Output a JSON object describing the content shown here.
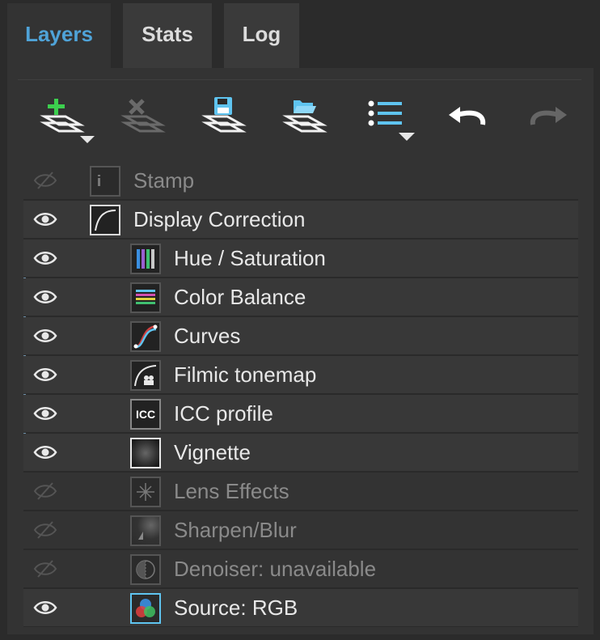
{
  "tabs": [
    {
      "label": "Layers"
    },
    {
      "label": "Stats"
    },
    {
      "label": "Log"
    }
  ],
  "toolbar": {
    "buttons": [
      {
        "icon": "add-layer-icon"
      },
      {
        "icon": "delete-layer-icon"
      },
      {
        "icon": "save-layers-icon"
      },
      {
        "icon": "open-layers-icon"
      },
      {
        "icon": "list-menu-icon"
      },
      {
        "icon": "undo-icon"
      },
      {
        "icon": "redo-icon"
      }
    ]
  },
  "layers": [
    {
      "label": "Stamp",
      "visible": false
    },
    {
      "label": "Display Correction",
      "visible": true
    },
    {
      "label": "Hue / Saturation",
      "visible": true
    },
    {
      "label": "Color Balance",
      "visible": true
    },
    {
      "label": "Curves",
      "visible": true
    },
    {
      "label": "Filmic tonemap",
      "visible": true
    },
    {
      "label": "ICC profile",
      "visible": true,
      "icon_text": "ICC"
    },
    {
      "label": "Vignette",
      "visible": true
    },
    {
      "label": "Lens Effects",
      "visible": false
    },
    {
      "label": "Sharpen/Blur",
      "visible": false
    },
    {
      "label": "Denoiser: unavailable",
      "visible": false
    },
    {
      "label": "Source: RGB",
      "visible": true
    }
  ],
  "colors": {
    "accent": "#4fa3d8",
    "add_green": "#3ccf4e",
    "icon_blue": "#5fc4f0"
  }
}
